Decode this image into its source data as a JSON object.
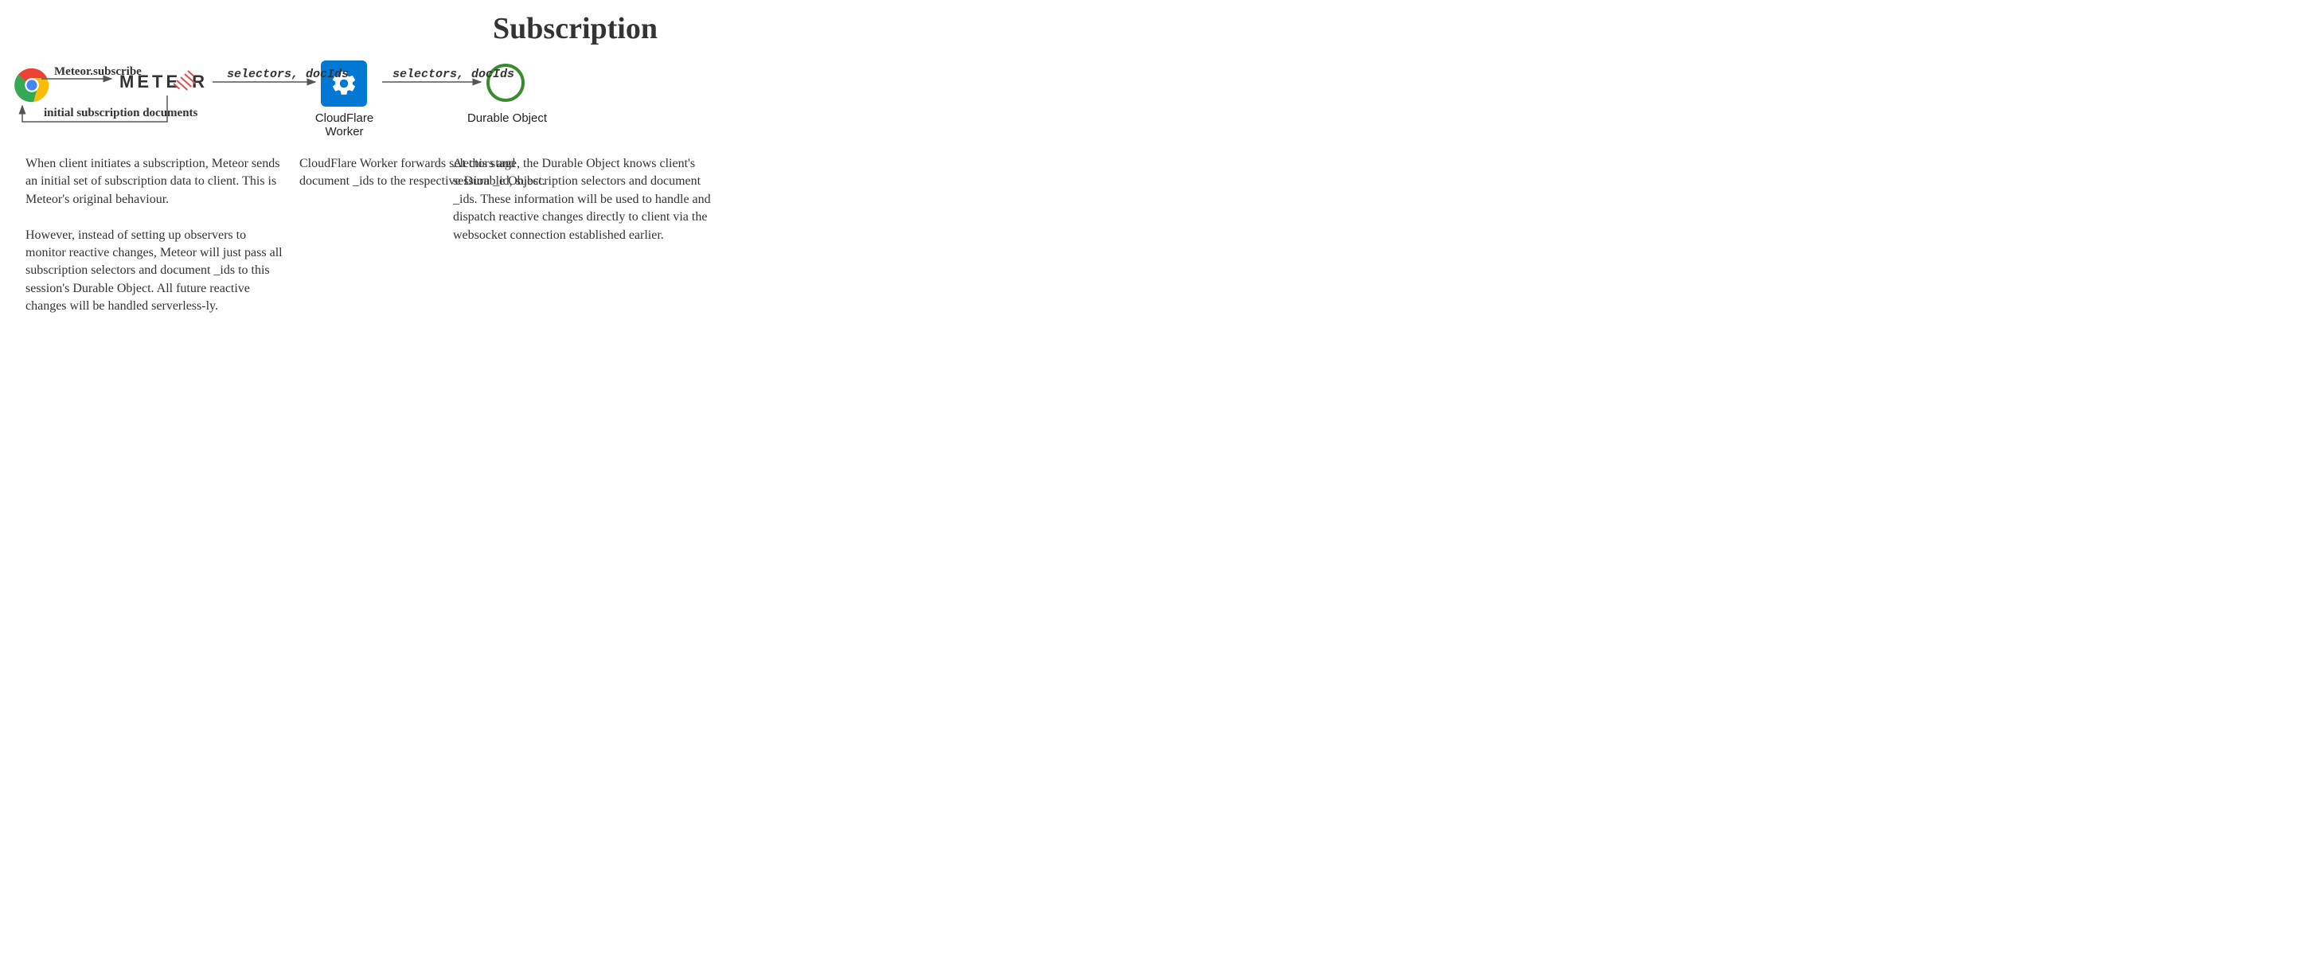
{
  "title": "Subscription",
  "nodes": {
    "chrome": {
      "name": "Chrome browser client"
    },
    "meteor": {
      "text_before": "METE",
      "text_after": "R"
    },
    "cloudflare_worker": {
      "label": "CloudFlare Worker"
    },
    "durable_object": {
      "label": "Durable Object"
    }
  },
  "edges": {
    "chrome_to_meteor": {
      "label": "Meteor.subscribe"
    },
    "meteor_to_chrome": {
      "label": "initial subscription documents"
    },
    "meteor_to_cfworker": {
      "label": "selectors, docIds"
    },
    "cfworker_to_durable": {
      "label": "selectors, docIds"
    }
  },
  "descriptions": {
    "col1": "When client initiates a subscription, Meteor sends an initial set of subscription data to client. This is Meteor's original behaviour.\n\nHowever, instead of setting up observers to monitor reactive changes, Meteor will just pass all subscription selectors and document _ids to this session's Durable Object. All future reactive changes will be handled serverless-ly.",
    "col2": "CloudFlare Worker forwards selectors and document _ids to the respective Durable Object.",
    "col3": "At this stage, the Durable Object knows client's session _id, subscription selectors and document _ids. These information will be used to handle and dispatch reactive changes directly to client via the websocket connection established earlier."
  }
}
